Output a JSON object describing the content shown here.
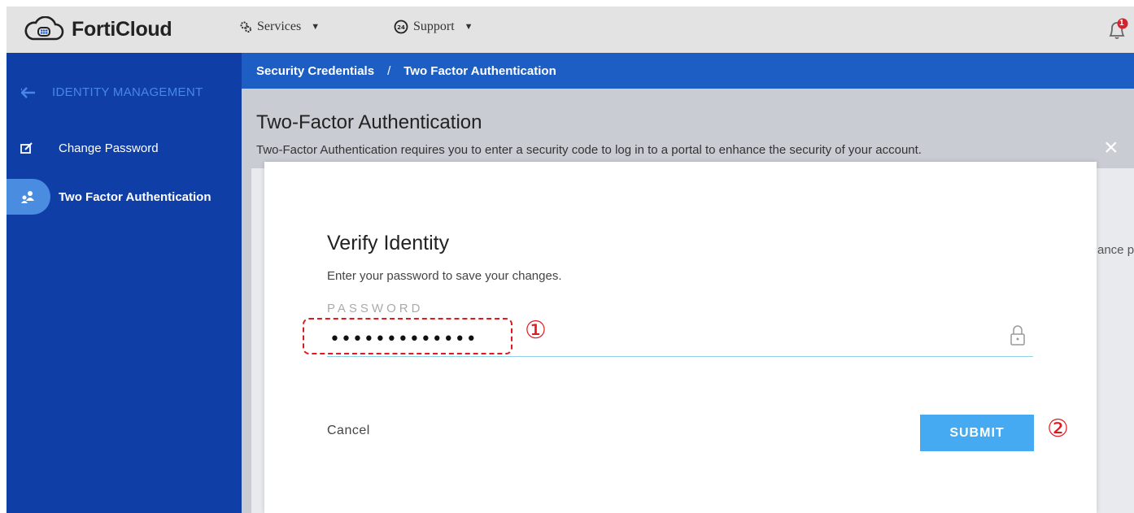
{
  "header": {
    "brand": "FortiCloud",
    "nav": [
      {
        "label": "Services",
        "icon": "gears-icon"
      },
      {
        "label": "Support",
        "icon": "support-24-icon"
      }
    ],
    "notification_count": "1"
  },
  "sidebar": {
    "section_title": "IDENTITY MANAGEMENT",
    "items": [
      {
        "label": "Change Password",
        "icon": "edit-icon",
        "active": false
      },
      {
        "label": "Two Factor Authentication",
        "icon": "people-icon",
        "active": true
      }
    ]
  },
  "breadcrumb": {
    "parent": "Security Credentials",
    "separator": "/",
    "current": "Two Factor Authentication"
  },
  "page": {
    "title": "Two-Factor Authentication",
    "description": "Two-Factor Authentication requires you to enter a security code to log in to a portal to enhance the security of your account.",
    "obscured_text": "ance p"
  },
  "modal": {
    "title": "Verify Identity",
    "description": "Enter your password to save your changes.",
    "password_label": "PASSWORD",
    "password_value": "•••••••••••••",
    "cancel_label": "Cancel",
    "submit_label": "SUBMIT",
    "close_glyph": "×"
  },
  "annotations": {
    "step1": "①",
    "step2": "②",
    "color": "#e0191f"
  },
  "colors": {
    "sidebar": "#0f3fa6",
    "breadcrumb_bar": "#1c5ec4",
    "submit": "#45aaf2",
    "active_item": "#4a8de0"
  }
}
